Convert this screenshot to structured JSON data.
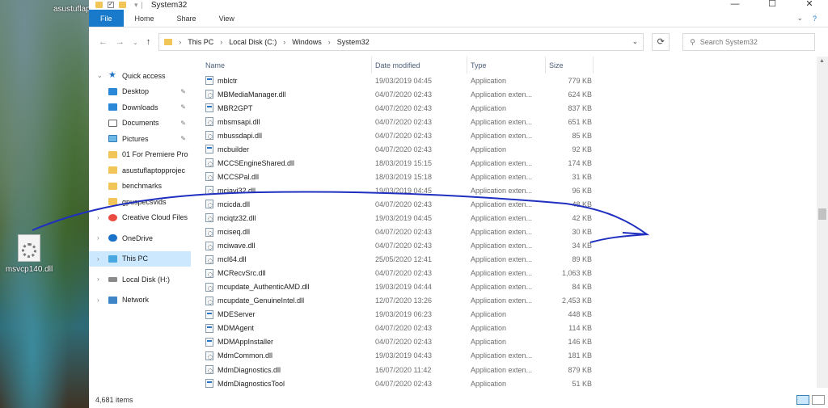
{
  "desktop": {
    "top_label": "asustuflap",
    "file_label": "msvcp140.dll"
  },
  "window": {
    "title": "System32",
    "controls": {
      "minimize": "—",
      "maximize": "☐",
      "close": "✕"
    }
  },
  "ribbon": {
    "tabs": [
      "File",
      "Home",
      "Share",
      "View"
    ]
  },
  "address": {
    "crumbs": [
      "This PC",
      "Local Disk (C:)",
      "Windows",
      "System32"
    ],
    "search_placeholder": "Search System32"
  },
  "nav": {
    "items": [
      {
        "label": "Quick access",
        "icon": "star-icon",
        "kind": "top"
      },
      {
        "label": "Desktop",
        "icon": "desktop-icon",
        "pinned": true
      },
      {
        "label": "Downloads",
        "icon": "download-icon",
        "pinned": true
      },
      {
        "label": "Documents",
        "icon": "documents-icon",
        "pinned": true
      },
      {
        "label": "Pictures",
        "icon": "pictures-icon",
        "pinned": true
      },
      {
        "label": "01 For Premiere Pro",
        "icon": "folder-icon"
      },
      {
        "label": "asustuflaptopprojec",
        "icon": "folder-icon"
      },
      {
        "label": "benchmarks",
        "icon": "folder-icon"
      },
      {
        "label": "gpuspecsvids",
        "icon": "folder-icon"
      },
      {
        "label": "Creative Cloud Files",
        "icon": "creative-cloud-icon"
      },
      {
        "label": "OneDrive",
        "icon": "onedrive-icon"
      },
      {
        "label": "This PC",
        "icon": "pc-icon",
        "selected": true
      },
      {
        "label": "Local Disk (H:)",
        "icon": "drive-icon"
      },
      {
        "label": "Network",
        "icon": "network-icon"
      }
    ]
  },
  "columns": {
    "name": "Name",
    "date": "Date modified",
    "type": "Type",
    "size": "Size"
  },
  "files": [
    {
      "name": "mblctr",
      "date": "19/03/2019 04:45",
      "type": "Application",
      "size": "779 KB",
      "kind": "app"
    },
    {
      "name": "MBMediaManager.dll",
      "date": "04/07/2020 02:43",
      "type": "Application exten...",
      "size": "624 KB",
      "kind": "dll"
    },
    {
      "name": "MBR2GPT",
      "date": "04/07/2020 02:43",
      "type": "Application",
      "size": "837 KB",
      "kind": "app"
    },
    {
      "name": "mbsmsapi.dll",
      "date": "04/07/2020 02:43",
      "type": "Application exten...",
      "size": "651 KB",
      "kind": "dll"
    },
    {
      "name": "mbussdapi.dll",
      "date": "04/07/2020 02:43",
      "type": "Application exten...",
      "size": "85 KB",
      "kind": "dll"
    },
    {
      "name": "mcbuilder",
      "date": "04/07/2020 02:43",
      "type": "Application",
      "size": "92 KB",
      "kind": "app"
    },
    {
      "name": "MCCSEngineShared.dll",
      "date": "18/03/2019 15:15",
      "type": "Application exten...",
      "size": "174 KB",
      "kind": "dll"
    },
    {
      "name": "MCCSPal.dll",
      "date": "18/03/2019 15:18",
      "type": "Application exten...",
      "size": "31 KB",
      "kind": "dll"
    },
    {
      "name": "mciavi32.dll",
      "date": "19/03/2019 04:45",
      "type": "Application exten...",
      "size": "96 KB",
      "kind": "dll"
    },
    {
      "name": "mcicda.dll",
      "date": "04/07/2020 02:43",
      "type": "Application exten...",
      "size": "48 KB",
      "kind": "dll"
    },
    {
      "name": "mciqtz32.dll",
      "date": "19/03/2019 04:45",
      "type": "Application exten...",
      "size": "42 KB",
      "kind": "dll"
    },
    {
      "name": "mciseq.dll",
      "date": "04/07/2020 02:43",
      "type": "Application exten...",
      "size": "30 KB",
      "kind": "dll"
    },
    {
      "name": "mciwave.dll",
      "date": "04/07/2020 02:43",
      "type": "Application exten...",
      "size": "34 KB",
      "kind": "dll"
    },
    {
      "name": "mcl64.dll",
      "date": "25/05/2020 12:41",
      "type": "Application exten...",
      "size": "89 KB",
      "kind": "dll"
    },
    {
      "name": "MCRecvSrc.dll",
      "date": "04/07/2020 02:43",
      "type": "Application exten...",
      "size": "1,063 KB",
      "kind": "dll"
    },
    {
      "name": "mcupdate_AuthenticAMD.dll",
      "date": "19/03/2019 04:44",
      "type": "Application exten...",
      "size": "84 KB",
      "kind": "dll"
    },
    {
      "name": "mcupdate_GenuineIntel.dll",
      "date": "12/07/2020 13:26",
      "type": "Application exten...",
      "size": "2,453 KB",
      "kind": "dll"
    },
    {
      "name": "MDEServer",
      "date": "19/03/2019 06:23",
      "type": "Application",
      "size": "448 KB",
      "kind": "app"
    },
    {
      "name": "MDMAgent",
      "date": "04/07/2020 02:43",
      "type": "Application",
      "size": "114 KB",
      "kind": "app"
    },
    {
      "name": "MDMAppInstaller",
      "date": "04/07/2020 02:43",
      "type": "Application",
      "size": "146 KB",
      "kind": "app"
    },
    {
      "name": "MdmCommon.dll",
      "date": "19/03/2019 04:43",
      "type": "Application exten...",
      "size": "181 KB",
      "kind": "dll"
    },
    {
      "name": "MdmDiagnostics.dll",
      "date": "16/07/2020 11:42",
      "type": "Application exten...",
      "size": "879 KB",
      "kind": "dll"
    },
    {
      "name": "MdmDiagnosticsTool",
      "date": "04/07/2020 02:43",
      "type": "Application",
      "size": "51 KB",
      "kind": "app"
    }
  ],
  "status": {
    "item_count": "4,681 items"
  },
  "annotation": {
    "color": "#1f2fbf"
  }
}
